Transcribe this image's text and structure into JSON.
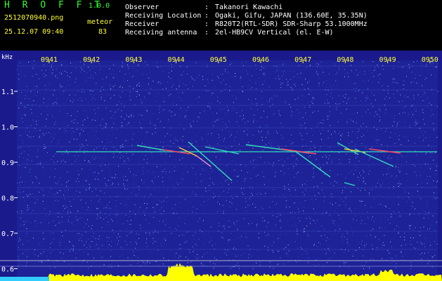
{
  "header": {
    "app_title": "H R O F F T",
    "version": "1.0.0",
    "filename": "2512070940.png",
    "datetime": "25.12.07 09:40",
    "meteor_label": "meteor",
    "meteor_count": "83",
    "info": [
      {
        "label": "Observer",
        "value": "Takanori Kawachi"
      },
      {
        "label": "Receiving Location",
        "value": "Ogaki, Gifu, JAPAN (136.60E, 35.35N)"
      },
      {
        "label": "Receiver",
        "value": "R820T2(RTL-SDR) SDR-Sharp 53.1000MHz"
      },
      {
        "label": "Receiving antenna",
        "value": "2el-HB9CV Vertical (el. E-W)"
      }
    ],
    "separator": ":"
  },
  "plot": {
    "unit_label": "kHz",
    "time_labels": [
      "0941",
      "0942",
      "0943",
      "0944",
      "0945",
      "0946",
      "0947",
      "0948",
      "0949",
      "0950"
    ],
    "freq_labels": [
      "1.1",
      "1.0",
      "0.9",
      "0.8",
      "0.7",
      "0.6"
    ],
    "colors": {
      "background": "#1a1a8c",
      "noise": "#5a7cff",
      "carrier": "#33ddbb",
      "echo": "#ff4466",
      "baseline": "#ffff00",
      "text_yellow": "#ffff33"
    }
  }
}
